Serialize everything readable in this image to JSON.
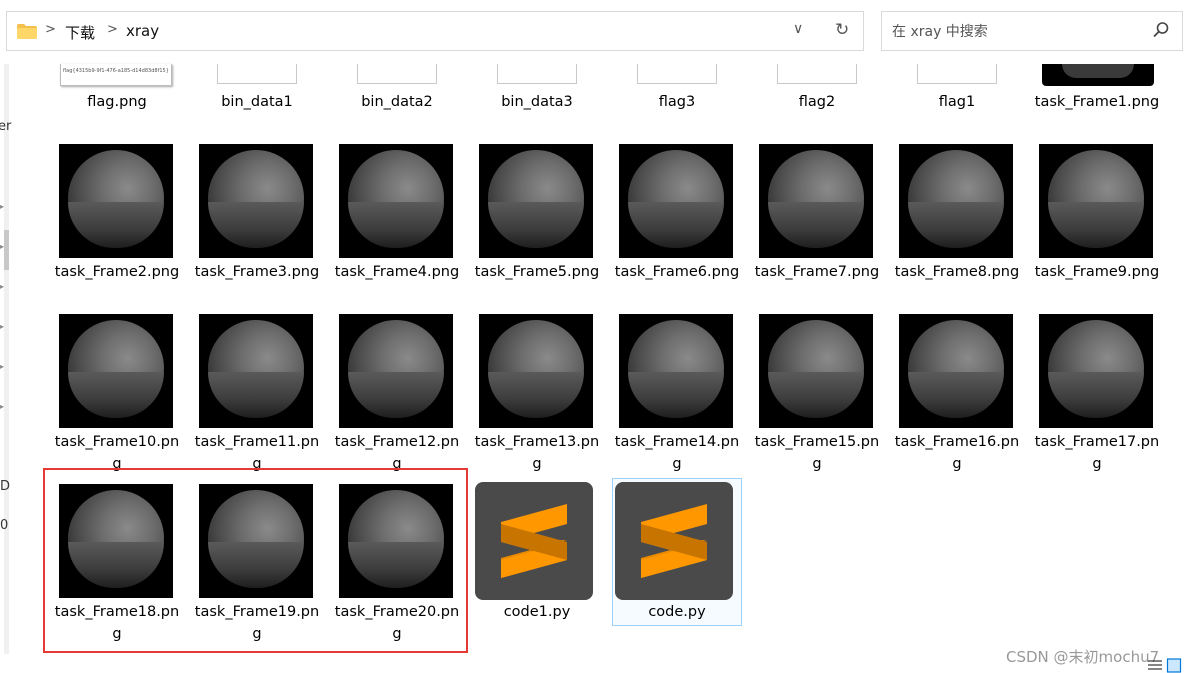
{
  "breadcrumb": [
    "下载",
    "xray"
  ],
  "search": {
    "placeholder": "在 xray 中搜索"
  },
  "nav_fragments": [
    "er",
    "D",
    "0"
  ],
  "files": [
    {
      "name": "flag.png",
      "kind": "flag-image"
    },
    {
      "name": "bin_data1",
      "kind": "blank"
    },
    {
      "name": "bin_data2",
      "kind": "blank"
    },
    {
      "name": "bin_data3",
      "kind": "blank"
    },
    {
      "name": "flag3",
      "kind": "blank"
    },
    {
      "name": "flag2",
      "kind": "blank"
    },
    {
      "name": "flag1",
      "kind": "blank"
    },
    {
      "name": "task_Frame1.png",
      "kind": "xray-partial"
    },
    {
      "name": "task_Frame2.png",
      "kind": "xray"
    },
    {
      "name": "task_Frame3.png",
      "kind": "xray"
    },
    {
      "name": "task_Frame4.png",
      "kind": "xray"
    },
    {
      "name": "task_Frame5.png",
      "kind": "xray"
    },
    {
      "name": "task_Frame6.png",
      "kind": "xray"
    },
    {
      "name": "task_Frame7.png",
      "kind": "xray"
    },
    {
      "name": "task_Frame8.png",
      "kind": "xray"
    },
    {
      "name": "task_Frame9.png",
      "kind": "xray"
    },
    {
      "name": "task_Frame10.png",
      "kind": "xray"
    },
    {
      "name": "task_Frame11.png",
      "kind": "xray"
    },
    {
      "name": "task_Frame12.png",
      "kind": "xray"
    },
    {
      "name": "task_Frame13.png",
      "kind": "xray"
    },
    {
      "name": "task_Frame14.png",
      "kind": "xray"
    },
    {
      "name": "task_Frame15.png",
      "kind": "xray"
    },
    {
      "name": "task_Frame16.png",
      "kind": "xray"
    },
    {
      "name": "task_Frame17.png",
      "kind": "xray"
    },
    {
      "name": "task_Frame18.png",
      "kind": "xray"
    },
    {
      "name": "task_Frame19.png",
      "kind": "xray"
    },
    {
      "name": "task_Frame20.png",
      "kind": "xray"
    },
    {
      "name": "code1.py",
      "kind": "sublime"
    },
    {
      "name": "code.py",
      "kind": "sublime",
      "selected": true
    }
  ],
  "flag_thumb_text": "flag{4315b9-9f1-476-a185-d14d83d8f15}",
  "highlight_color": "#e53935",
  "sublime_accent": "#ff9800",
  "watermark": "CSDN @末初mochu7"
}
